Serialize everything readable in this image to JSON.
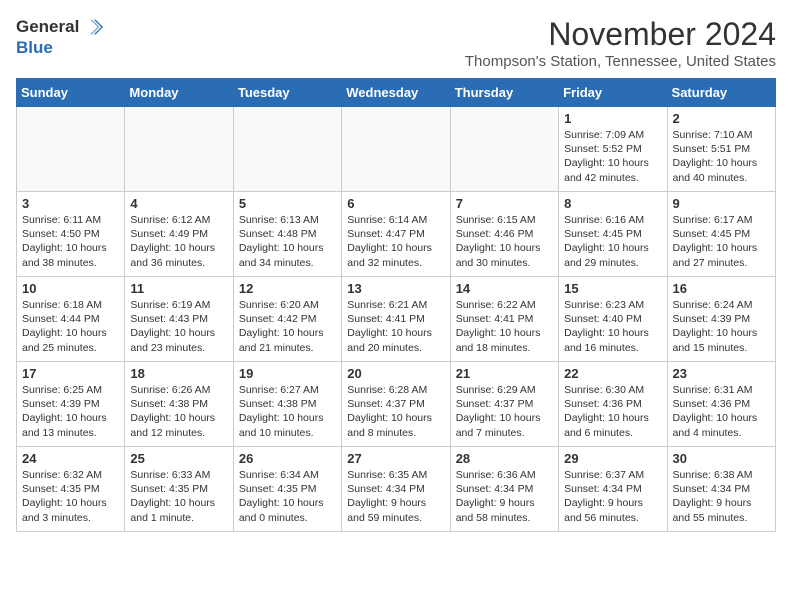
{
  "header": {
    "logo_general": "General",
    "logo_blue": "Blue",
    "month_title": "November 2024",
    "location": "Thompson's Station, Tennessee, United States"
  },
  "calendar": {
    "days_of_week": [
      "Sunday",
      "Monday",
      "Tuesday",
      "Wednesday",
      "Thursday",
      "Friday",
      "Saturday"
    ],
    "weeks": [
      [
        {
          "day": "",
          "sunrise": "",
          "sunset": "",
          "daylight": "",
          "empty": true
        },
        {
          "day": "",
          "sunrise": "",
          "sunset": "",
          "daylight": "",
          "empty": true
        },
        {
          "day": "",
          "sunrise": "",
          "sunset": "",
          "daylight": "",
          "empty": true
        },
        {
          "day": "",
          "sunrise": "",
          "sunset": "",
          "daylight": "",
          "empty": true
        },
        {
          "day": "",
          "sunrise": "",
          "sunset": "",
          "daylight": "",
          "empty": true
        },
        {
          "day": "1",
          "sunrise": "Sunrise: 7:09 AM",
          "sunset": "Sunset: 5:52 PM",
          "daylight": "Daylight: 10 hours and 42 minutes."
        },
        {
          "day": "2",
          "sunrise": "Sunrise: 7:10 AM",
          "sunset": "Sunset: 5:51 PM",
          "daylight": "Daylight: 10 hours and 40 minutes."
        }
      ],
      [
        {
          "day": "3",
          "sunrise": "Sunrise: 6:11 AM",
          "sunset": "Sunset: 4:50 PM",
          "daylight": "Daylight: 10 hours and 38 minutes."
        },
        {
          "day": "4",
          "sunrise": "Sunrise: 6:12 AM",
          "sunset": "Sunset: 4:49 PM",
          "daylight": "Daylight: 10 hours and 36 minutes."
        },
        {
          "day": "5",
          "sunrise": "Sunrise: 6:13 AM",
          "sunset": "Sunset: 4:48 PM",
          "daylight": "Daylight: 10 hours and 34 minutes."
        },
        {
          "day": "6",
          "sunrise": "Sunrise: 6:14 AM",
          "sunset": "Sunset: 4:47 PM",
          "daylight": "Daylight: 10 hours and 32 minutes."
        },
        {
          "day": "7",
          "sunrise": "Sunrise: 6:15 AM",
          "sunset": "Sunset: 4:46 PM",
          "daylight": "Daylight: 10 hours and 30 minutes."
        },
        {
          "day": "8",
          "sunrise": "Sunrise: 6:16 AM",
          "sunset": "Sunset: 4:45 PM",
          "daylight": "Daylight: 10 hours and 29 minutes."
        },
        {
          "day": "9",
          "sunrise": "Sunrise: 6:17 AM",
          "sunset": "Sunset: 4:45 PM",
          "daylight": "Daylight: 10 hours and 27 minutes."
        }
      ],
      [
        {
          "day": "10",
          "sunrise": "Sunrise: 6:18 AM",
          "sunset": "Sunset: 4:44 PM",
          "daylight": "Daylight: 10 hours and 25 minutes."
        },
        {
          "day": "11",
          "sunrise": "Sunrise: 6:19 AM",
          "sunset": "Sunset: 4:43 PM",
          "daylight": "Daylight: 10 hours and 23 minutes."
        },
        {
          "day": "12",
          "sunrise": "Sunrise: 6:20 AM",
          "sunset": "Sunset: 4:42 PM",
          "daylight": "Daylight: 10 hours and 21 minutes."
        },
        {
          "day": "13",
          "sunrise": "Sunrise: 6:21 AM",
          "sunset": "Sunset: 4:41 PM",
          "daylight": "Daylight: 10 hours and 20 minutes."
        },
        {
          "day": "14",
          "sunrise": "Sunrise: 6:22 AM",
          "sunset": "Sunset: 4:41 PM",
          "daylight": "Daylight: 10 hours and 18 minutes."
        },
        {
          "day": "15",
          "sunrise": "Sunrise: 6:23 AM",
          "sunset": "Sunset: 4:40 PM",
          "daylight": "Daylight: 10 hours and 16 minutes."
        },
        {
          "day": "16",
          "sunrise": "Sunrise: 6:24 AM",
          "sunset": "Sunset: 4:39 PM",
          "daylight": "Daylight: 10 hours and 15 minutes."
        }
      ],
      [
        {
          "day": "17",
          "sunrise": "Sunrise: 6:25 AM",
          "sunset": "Sunset: 4:39 PM",
          "daylight": "Daylight: 10 hours and 13 minutes."
        },
        {
          "day": "18",
          "sunrise": "Sunrise: 6:26 AM",
          "sunset": "Sunset: 4:38 PM",
          "daylight": "Daylight: 10 hours and 12 minutes."
        },
        {
          "day": "19",
          "sunrise": "Sunrise: 6:27 AM",
          "sunset": "Sunset: 4:38 PM",
          "daylight": "Daylight: 10 hours and 10 minutes."
        },
        {
          "day": "20",
          "sunrise": "Sunrise: 6:28 AM",
          "sunset": "Sunset: 4:37 PM",
          "daylight": "Daylight: 10 hours and 8 minutes."
        },
        {
          "day": "21",
          "sunrise": "Sunrise: 6:29 AM",
          "sunset": "Sunset: 4:37 PM",
          "daylight": "Daylight: 10 hours and 7 minutes."
        },
        {
          "day": "22",
          "sunrise": "Sunrise: 6:30 AM",
          "sunset": "Sunset: 4:36 PM",
          "daylight": "Daylight: 10 hours and 6 minutes."
        },
        {
          "day": "23",
          "sunrise": "Sunrise: 6:31 AM",
          "sunset": "Sunset: 4:36 PM",
          "daylight": "Daylight: 10 hours and 4 minutes."
        }
      ],
      [
        {
          "day": "24",
          "sunrise": "Sunrise: 6:32 AM",
          "sunset": "Sunset: 4:35 PM",
          "daylight": "Daylight: 10 hours and 3 minutes."
        },
        {
          "day": "25",
          "sunrise": "Sunrise: 6:33 AM",
          "sunset": "Sunset: 4:35 PM",
          "daylight": "Daylight: 10 hours and 1 minute."
        },
        {
          "day": "26",
          "sunrise": "Sunrise: 6:34 AM",
          "sunset": "Sunset: 4:35 PM",
          "daylight": "Daylight: 10 hours and 0 minutes."
        },
        {
          "day": "27",
          "sunrise": "Sunrise: 6:35 AM",
          "sunset": "Sunset: 4:34 PM",
          "daylight": "Daylight: 9 hours and 59 minutes."
        },
        {
          "day": "28",
          "sunrise": "Sunrise: 6:36 AM",
          "sunset": "Sunset: 4:34 PM",
          "daylight": "Daylight: 9 hours and 58 minutes."
        },
        {
          "day": "29",
          "sunrise": "Sunrise: 6:37 AM",
          "sunset": "Sunset: 4:34 PM",
          "daylight": "Daylight: 9 hours and 56 minutes."
        },
        {
          "day": "30",
          "sunrise": "Sunrise: 6:38 AM",
          "sunset": "Sunset: 4:34 PM",
          "daylight": "Daylight: 9 hours and 55 minutes."
        }
      ]
    ]
  }
}
